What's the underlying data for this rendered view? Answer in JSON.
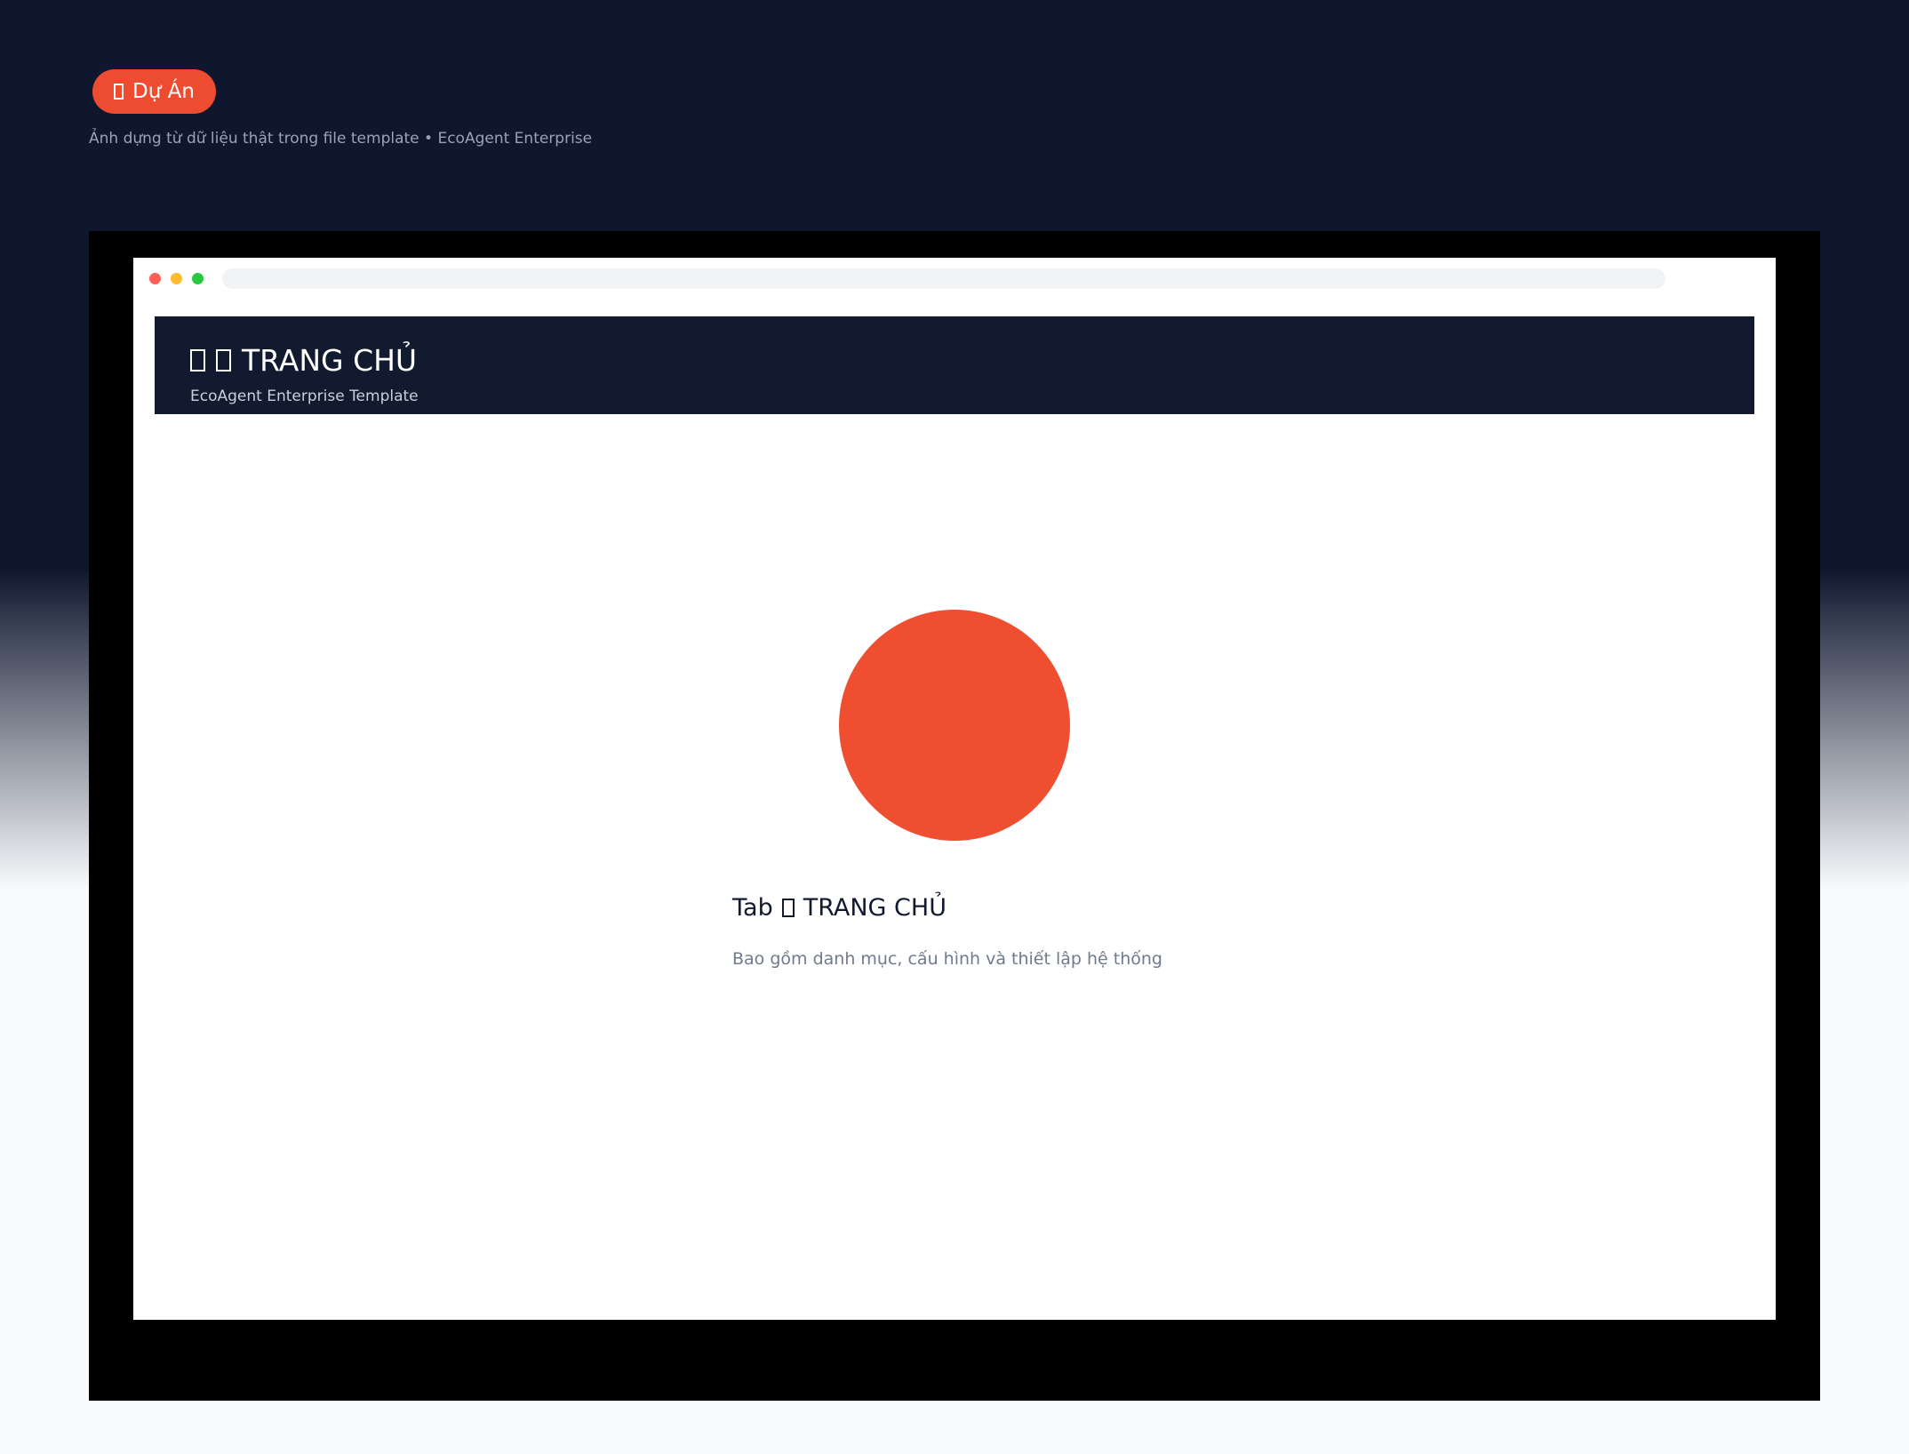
{
  "badge": {
    "icon": "box-glyph-icon",
    "label": "Dự Án"
  },
  "caption": "Ảnh dựng từ dữ liệu thật trong file template • EcoAgent Enterprise",
  "window": {
    "controls": [
      "close",
      "minimize",
      "maximize"
    ]
  },
  "header": {
    "icons": [
      "box-glyph-icon",
      "box-glyph-icon"
    ],
    "title": "TRANG CHỦ",
    "subtitle": "EcoAgent Enterprise Template"
  },
  "main": {
    "tab_prefix": "Tab",
    "tab_icon": "box-glyph-icon",
    "tab_title": "TRANG CHỦ",
    "description": "Bao gồm danh mục, cấu hình và thiết lập hệ thống"
  },
  "colors": {
    "background_top": "#0f172e",
    "background_bottom": "#f8fafc",
    "accent": "#ee4c30",
    "header": "#111a2f",
    "window": "#ffffff",
    "frame": "#000000"
  }
}
